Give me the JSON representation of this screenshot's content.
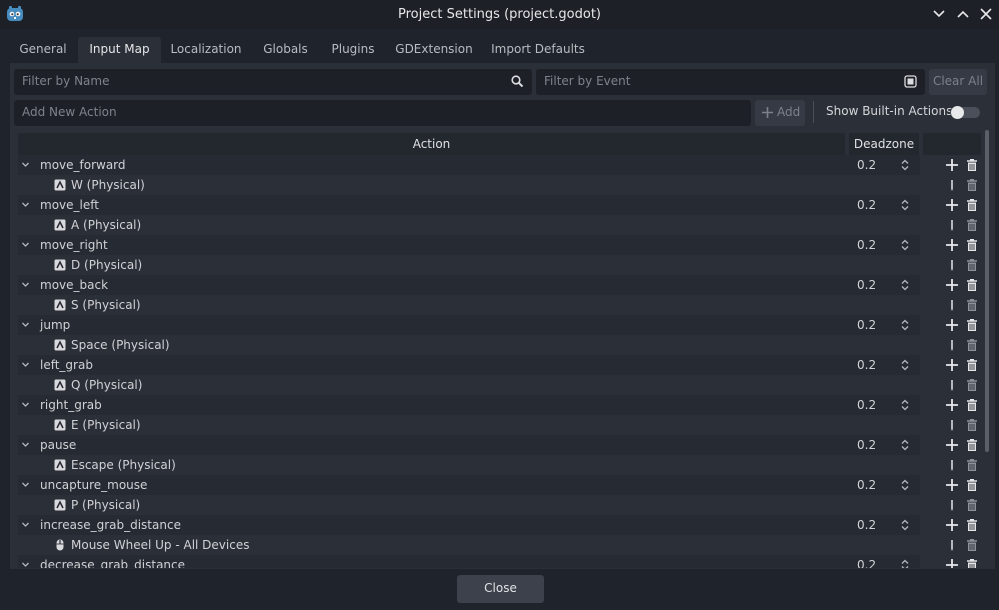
{
  "window": {
    "title": "Project Settings (project.godot)"
  },
  "tabs": [
    "General",
    "Input Map",
    "Localization",
    "Globals",
    "Plugins",
    "GDExtension",
    "Import Defaults"
  ],
  "filters": {
    "name_placeholder": "Filter by Name",
    "event_placeholder": "Filter by Event",
    "clear_all": "Clear All"
  },
  "add_action": {
    "placeholder": "Add New Action",
    "add_label": "Add",
    "show_builtin": "Show Built-in Actions"
  },
  "table": {
    "col_action": "Action",
    "col_deadzone": "Deadzone",
    "actions": [
      {
        "name": "move_forward",
        "deadzone": "0.2",
        "event": "W (Physical)",
        "event_icon": "keyboard-icon"
      },
      {
        "name": "move_left",
        "deadzone": "0.2",
        "event": "A (Physical)",
        "event_icon": "keyboard-icon"
      },
      {
        "name": "move_right",
        "deadzone": "0.2",
        "event": "D (Physical)",
        "event_icon": "keyboard-icon"
      },
      {
        "name": "move_back",
        "deadzone": "0.2",
        "event": "S (Physical)",
        "event_icon": "keyboard-icon"
      },
      {
        "name": "jump",
        "deadzone": "0.2",
        "event": "Space (Physical)",
        "event_icon": "keyboard-icon"
      },
      {
        "name": "left_grab",
        "deadzone": "0.2",
        "event": "Q (Physical)",
        "event_icon": "keyboard-icon"
      },
      {
        "name": "right_grab",
        "deadzone": "0.2",
        "event": "E (Physical)",
        "event_icon": "keyboard-icon"
      },
      {
        "name": "pause",
        "deadzone": "0.2",
        "event": "Escape (Physical)",
        "event_icon": "keyboard-icon"
      },
      {
        "name": "uncapture_mouse",
        "deadzone": "0.2",
        "event": "P (Physical)",
        "event_icon": "keyboard-icon"
      },
      {
        "name": "increase_grab_distance",
        "deadzone": "0.2",
        "event": "Mouse Wheel Up - All Devices",
        "event_icon": "mouse-icon"
      },
      {
        "name": "decrease_grab_distance",
        "deadzone": "0.2",
        "event": null,
        "event_icon": null
      }
    ]
  },
  "footer": {
    "close_label": "Close"
  },
  "colors": {
    "accent": "#478cbf",
    "panel": "#2b2f38",
    "background": "#1f232b"
  }
}
